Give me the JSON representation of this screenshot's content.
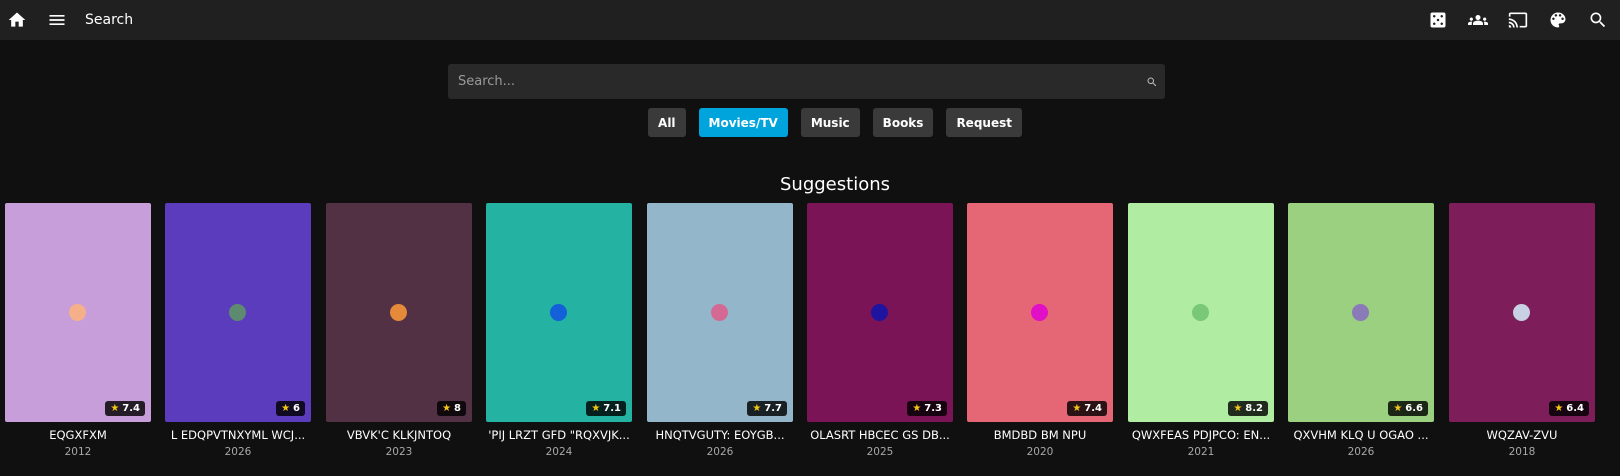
{
  "header": {
    "title": "Search",
    "left_icons": [
      "home-icon",
      "menu-icon"
    ],
    "right_icons": [
      "dice-icon",
      "users-icon",
      "cast-icon",
      "palette-icon",
      "search-icon"
    ]
  },
  "search": {
    "placeholder": "Search...",
    "value": ""
  },
  "filters": [
    {
      "label": "All",
      "active": false
    },
    {
      "label": "Movies/TV",
      "active": true
    },
    {
      "label": "Music",
      "active": false
    },
    {
      "label": "Books",
      "active": false
    },
    {
      "label": "Request",
      "active": false
    }
  ],
  "suggestions": {
    "title": "Suggestions",
    "items": [
      {
        "title": "EQGXFXM",
        "year": "2012",
        "rating": "7.4",
        "color": "#c79ed9",
        "dot_color": "#f5b08a"
      },
      {
        "title": "L EDQPVTNXYML WCJ...",
        "year": "2026",
        "rating": "6",
        "color": "#5b3cbc",
        "dot_color": "#5e8a70"
      },
      {
        "title": "VBVK'C KLKJNTOQ",
        "year": "2023",
        "rating": "8",
        "color": "#533144",
        "dot_color": "#e48a3a"
      },
      {
        "title": "'PIJ LRZT GFD \"RQXVJK...",
        "year": "2024",
        "rating": "7.1",
        "color": "#24b2a3",
        "dot_color": "#1360d8"
      },
      {
        "title": "HNQTVGUTY: EOYGB...",
        "year": "2026",
        "rating": "7.7",
        "color": "#93b6ca",
        "dot_color": "#d46a93"
      },
      {
        "title": "OLASRT HBCEC GS DB...",
        "year": "2025",
        "rating": "7.3",
        "color": "#7b1456",
        "dot_color": "#1e14a0"
      },
      {
        "title": "BMDBD BM NPU",
        "year": "2020",
        "rating": "7.4",
        "color": "#e56675",
        "dot_color": "#e10fc6"
      },
      {
        "title": "QWXFEAS PDJPCO: EN...",
        "year": "2021",
        "rating": "8.2",
        "color": "#b0eca1",
        "dot_color": "#78c878"
      },
      {
        "title": "QXVHM KLQ U OGAO ...",
        "year": "2026",
        "rating": "6.6",
        "color": "#9ad07f",
        "dot_color": "#8a7ab8"
      },
      {
        "title": "WQZAV-ZVU",
        "year": "2018",
        "rating": "6.4",
        "color": "#7d1e5a",
        "dot_color": "#c8d0e4"
      }
    ]
  }
}
